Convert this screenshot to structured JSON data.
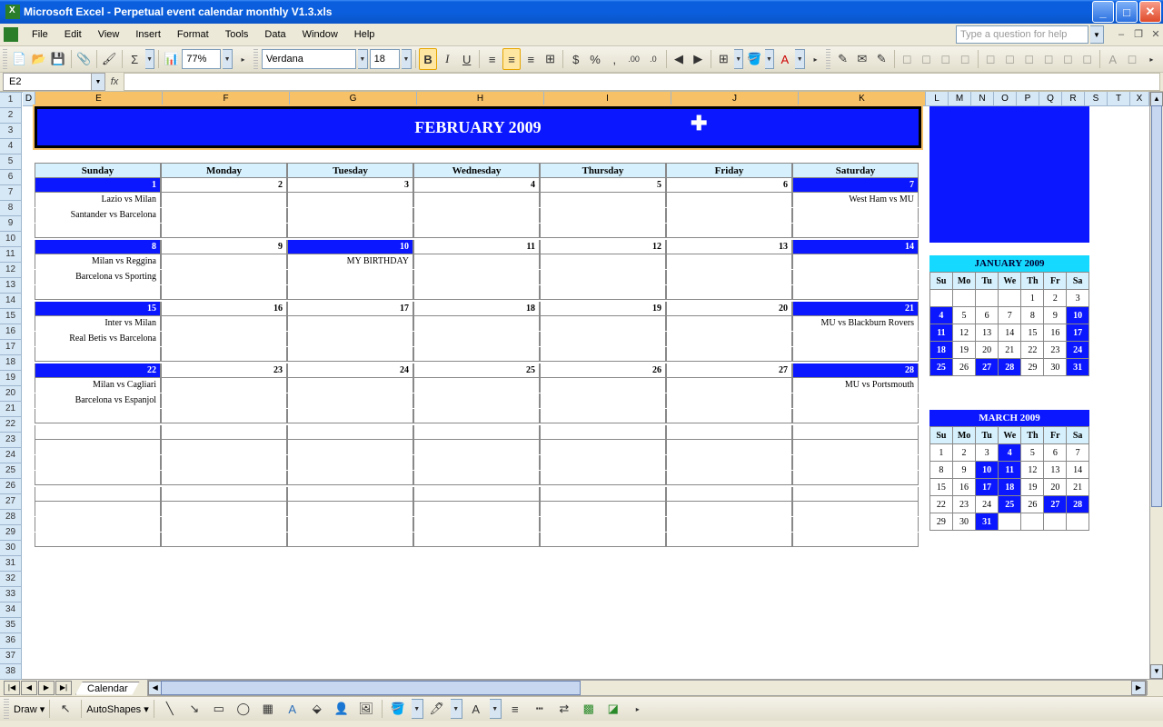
{
  "titlebar": {
    "app": "Microsoft Excel",
    "doc": "Perpetual event calendar monthly V1.3.xls"
  },
  "menu": [
    "File",
    "Edit",
    "View",
    "Insert",
    "Format",
    "Tools",
    "Data",
    "Window",
    "Help"
  ],
  "help_placeholder": "Type a question for help",
  "toolbar1": {
    "zoom": "77%"
  },
  "toolbar2": {
    "font": "Verdana",
    "size": "18"
  },
  "namebox": "E2",
  "cols": [
    "D",
    "E",
    "F",
    "G",
    "H",
    "I",
    "J",
    "K",
    "L",
    "M",
    "N",
    "O",
    "P",
    "Q",
    "R",
    "S",
    "T",
    "X"
  ],
  "rows": 38,
  "calendar": {
    "title": "FEBRUARY 2009",
    "days": [
      "Sunday",
      "Monday",
      "Tuesday",
      "Wednesday",
      "Thursday",
      "Friday",
      "Saturday"
    ],
    "weeks": [
      [
        {
          "n": 1,
          "ev": [
            "Lazio vs Milan",
            "Santander vs Barcelona"
          ]
        },
        {
          "n": 2
        },
        {
          "n": 3
        },
        {
          "n": 4
        },
        {
          "n": 5
        },
        {
          "n": 6
        },
        {
          "n": 7,
          "ev": [
            "West Ham vs MU"
          ]
        }
      ],
      [
        {
          "n": 8,
          "ev": [
            "Milan vs Reggina",
            "Barcelona vs Sporting"
          ]
        },
        {
          "n": 9
        },
        {
          "n": 10,
          "ev": [
            "MY BIRTHDAY"
          ],
          "hl": true
        },
        {
          "n": 11
        },
        {
          "n": 12
        },
        {
          "n": 13
        },
        {
          "n": 14
        }
      ],
      [
        {
          "n": 15,
          "ev": [
            "Inter vs Milan",
            "Real Betis vs Barcelona"
          ]
        },
        {
          "n": 16
        },
        {
          "n": 17
        },
        {
          "n": 18
        },
        {
          "n": 19
        },
        {
          "n": 20
        },
        {
          "n": 21,
          "ev": [
            "MU vs Blackburn Rovers"
          ]
        }
      ],
      [
        {
          "n": 22,
          "ev": [
            "Milan vs Cagliari",
            "Barcelona vs Espanjol"
          ]
        },
        {
          "n": 23
        },
        {
          "n": 24
        },
        {
          "n": 25
        },
        {
          "n": 26
        },
        {
          "n": 27
        },
        {
          "n": 28,
          "ev": [
            "MU vs Portsmouth"
          ]
        }
      ],
      [
        {},
        {},
        {},
        {},
        {},
        {},
        {}
      ],
      [
        {},
        {},
        {},
        {},
        {},
        {},
        {}
      ]
    ]
  },
  "mini1": {
    "title": "JANUARY 2009",
    "hd": [
      "Su",
      "Mo",
      "Tu",
      "We",
      "Th",
      "Fr",
      "Sa"
    ],
    "rows": [
      [
        {
          "v": ""
        },
        {
          "v": ""
        },
        {
          "v": ""
        },
        {
          "v": ""
        },
        {
          "v": "1"
        },
        {
          "v": "2"
        },
        {
          "v": "3"
        }
      ],
      [
        {
          "v": "4",
          "hl": 1
        },
        {
          "v": "5"
        },
        {
          "v": "6"
        },
        {
          "v": "7"
        },
        {
          "v": "8"
        },
        {
          "v": "9"
        },
        {
          "v": "10",
          "hl": 1
        }
      ],
      [
        {
          "v": "11",
          "hl": 1
        },
        {
          "v": "12"
        },
        {
          "v": "13"
        },
        {
          "v": "14"
        },
        {
          "v": "15"
        },
        {
          "v": "16"
        },
        {
          "v": "17",
          "hl": 1
        }
      ],
      [
        {
          "v": "18",
          "hl": 1
        },
        {
          "v": "19"
        },
        {
          "v": "20"
        },
        {
          "v": "21"
        },
        {
          "v": "22"
        },
        {
          "v": "23"
        },
        {
          "v": "24",
          "hl": 1
        }
      ],
      [
        {
          "v": "25",
          "hl": 1
        },
        {
          "v": "26"
        },
        {
          "v": "27",
          "hl": 1
        },
        {
          "v": "28",
          "hl": 1
        },
        {
          "v": "29"
        },
        {
          "v": "30"
        },
        {
          "v": "31",
          "hl": 1
        }
      ]
    ]
  },
  "mini2": {
    "title": "MARCH 2009",
    "hd": [
      "Su",
      "Mo",
      "Tu",
      "We",
      "Th",
      "Fr",
      "Sa"
    ],
    "rows": [
      [
        {
          "v": "1"
        },
        {
          "v": "2"
        },
        {
          "v": "3"
        },
        {
          "v": "4",
          "hl": 1
        },
        {
          "v": "5"
        },
        {
          "v": "6"
        },
        {
          "v": "7"
        }
      ],
      [
        {
          "v": "8"
        },
        {
          "v": "9"
        },
        {
          "v": "10",
          "hl": 1
        },
        {
          "v": "11",
          "hl": 1
        },
        {
          "v": "12"
        },
        {
          "v": "13"
        },
        {
          "v": "14"
        }
      ],
      [
        {
          "v": "15"
        },
        {
          "v": "16"
        },
        {
          "v": "17",
          "hl": 1
        },
        {
          "v": "18",
          "hl": 1
        },
        {
          "v": "19"
        },
        {
          "v": "20"
        },
        {
          "v": "21"
        }
      ],
      [
        {
          "v": "22"
        },
        {
          "v": "23"
        },
        {
          "v": "24"
        },
        {
          "v": "25",
          "hl": 1
        },
        {
          "v": "26"
        },
        {
          "v": "27",
          "hl": 1
        },
        {
          "v": "28",
          "hl": 1
        }
      ],
      [
        {
          "v": "29"
        },
        {
          "v": "30"
        },
        {
          "v": "31",
          "hl": 1
        },
        {
          "v": ""
        },
        {
          "v": ""
        },
        {
          "v": ""
        },
        {
          "v": ""
        }
      ]
    ]
  },
  "tab": "Calendar",
  "draw": {
    "label": "Draw",
    "autoshapes": "AutoShapes"
  }
}
